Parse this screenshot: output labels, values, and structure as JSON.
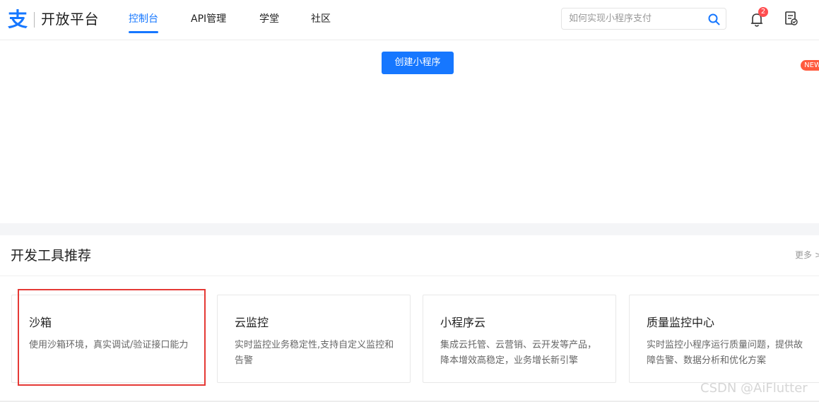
{
  "header": {
    "logo_glyph": "支",
    "title": "开放平台",
    "nav": [
      {
        "label": "控制台"
      },
      {
        "label": "API管理"
      },
      {
        "label": "学堂"
      },
      {
        "label": "社区"
      }
    ],
    "search_placeholder": "如何实现小程序支付",
    "notification_count": "2"
  },
  "main": {
    "create_button": "创建小程序"
  },
  "tools": {
    "title": "开发工具推荐",
    "more": "更多",
    "more_arrow": ">",
    "new_badge": "NEW",
    "cards": [
      {
        "title": "沙箱",
        "desc": "使用沙箱环境，真实调试/验证接口能力"
      },
      {
        "title": "云监控",
        "desc": "实时监控业务稳定性,支持自定义监控和告警"
      },
      {
        "title": "小程序云",
        "desc": "集成云托管、云营销、云开发等产品，降本增效高稳定，业务增长新引擎"
      },
      {
        "title": "质量监控中心",
        "desc": "实时监控小程序运行质量问题，提供故障告警、数据分析和优化方案"
      }
    ]
  },
  "watermark": "CSDN @AiFlutter",
  "colors": {
    "accent": "#1677ff",
    "badge_red": "#ff4d4f",
    "highlight_red": "#e53935",
    "new_badge": "#ff5a3d"
  },
  "icons": {
    "search": "search-icon",
    "bell": "bell-icon",
    "document": "document-icon",
    "chevron": "chevron-right-icon"
  }
}
